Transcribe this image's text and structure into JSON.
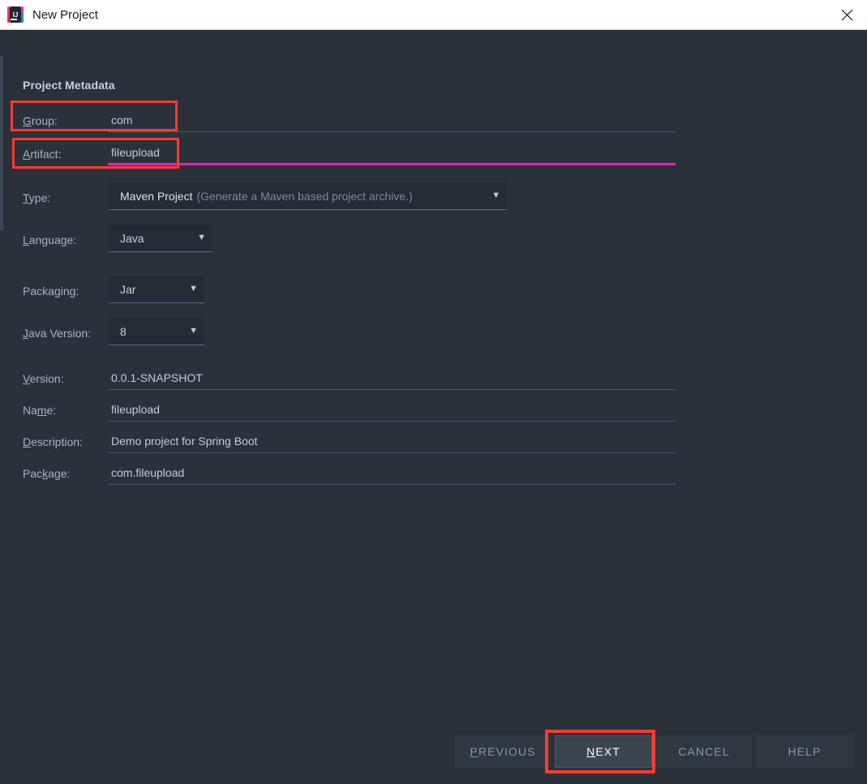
{
  "window": {
    "title": "New Project",
    "app_icon": "intellij-idea-icon",
    "icon_text": "IJ",
    "close_icon": "close-icon"
  },
  "form": {
    "section_title": "Project Metadata",
    "fields": [
      {
        "key": "group",
        "label": "Group:",
        "mnemonic": "G",
        "value": "com",
        "focused": false
      },
      {
        "key": "artifact",
        "label": "Artifact:",
        "mnemonic": "A",
        "value": "fileupload",
        "focused": true
      },
      {
        "key": "version",
        "label": "Version:",
        "mnemonic": "V",
        "value": "0.0.1-SNAPSHOT",
        "focused": false
      },
      {
        "key": "name",
        "label": "Name:",
        "mnemonic": "m",
        "value": "fileupload",
        "focused": false
      },
      {
        "key": "description",
        "label": "Description:",
        "mnemonic": "D",
        "value": "Demo project for Spring Boot",
        "focused": false
      },
      {
        "key": "package",
        "label": "Package:",
        "mnemonic": "k",
        "value": "com.fileupload",
        "focused": false
      }
    ],
    "combos": [
      {
        "key": "type",
        "label": "Type:",
        "mnemonic": "T",
        "value": "Maven Project",
        "hint": "(Generate a Maven based project archive.)",
        "arrow": "chevron-down-icon"
      },
      {
        "key": "language",
        "label": "Language:",
        "mnemonic": "L",
        "value": "Java",
        "hint": "",
        "arrow": "chevron-down-icon"
      },
      {
        "key": "packaging",
        "label": "Packaging:",
        "mnemonic": "g",
        "value": "Jar",
        "hint": "",
        "arrow": "chevron-down-icon"
      },
      {
        "key": "java_version",
        "label": "Java Version:",
        "mnemonic": "J",
        "value": "8",
        "hint": "",
        "arrow": "chevron-down-icon"
      }
    ]
  },
  "buttons": [
    {
      "key": "previous",
      "label": "PREVIOUS",
      "mnemonic": "P",
      "focused": false,
      "annotated": false
    },
    {
      "key": "next",
      "label": "NEXT",
      "mnemonic": "N",
      "focused": true,
      "annotated": true
    },
    {
      "key": "cancel",
      "label": "CANCEL",
      "mnemonic": "",
      "focused": false,
      "annotated": false
    },
    {
      "key": "help",
      "label": "HELP",
      "mnemonic": "",
      "focused": false,
      "annotated": false
    }
  ],
  "annotations": {
    "color": "#fb3b35",
    "focus_underline_color": "#e91ec0",
    "targets": [
      "group-field-row",
      "artifact-field-row",
      "next-button"
    ]
  }
}
